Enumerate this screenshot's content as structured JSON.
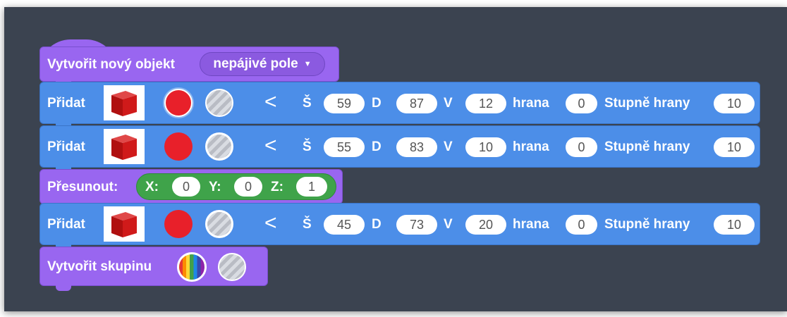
{
  "create_block": {
    "label": "Vytvořit nový objekt",
    "dropdown_value": "nepájivé pole"
  },
  "add_label": "Přidat",
  "dim_labels": {
    "s": "Š",
    "d": "D",
    "v": "V",
    "edge": "hrana",
    "edge_deg": "Stupně hrany"
  },
  "add_rows": [
    {
      "s": "59",
      "d": "87",
      "v": "12",
      "edge": "0",
      "edge_deg": "10"
    },
    {
      "s": "55",
      "d": "83",
      "v": "10",
      "edge": "0",
      "edge_deg": "10"
    },
    {
      "s": "45",
      "d": "73",
      "v": "20",
      "edge": "0",
      "edge_deg": "10"
    }
  ],
  "move_block": {
    "label": "Přesunout:",
    "x_label": "X:",
    "x": "0",
    "y_label": "Y:",
    "y": "0",
    "z_label": "Z:",
    "z": "1"
  },
  "group_block": {
    "label": "Vytvořit skupinu"
  },
  "colors": {
    "background": "#3b4350",
    "purple": "#9966f0",
    "blue": "#4c8ee8",
    "green": "#3fa34a",
    "red": "#e8202a"
  }
}
